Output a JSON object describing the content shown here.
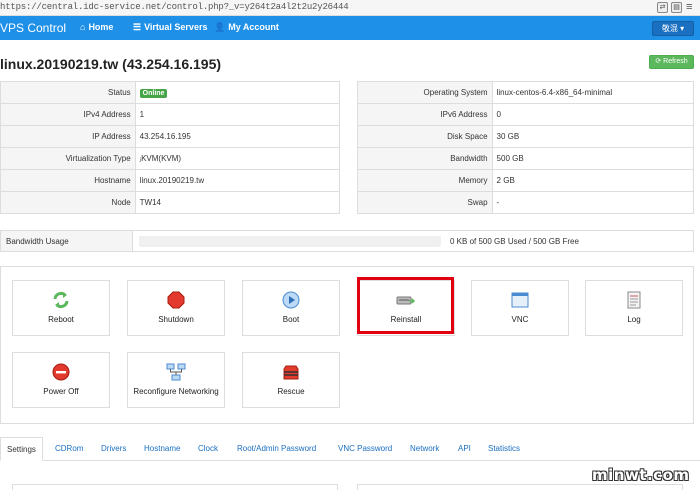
{
  "browser": {
    "url": "https://central.idc-service.net/control.php?_v=y264t2a4l2t2u2y26444"
  },
  "navbar": {
    "brand": "VPS Control",
    "items": [
      {
        "label": "Home",
        "icon": "home-icon"
      },
      {
        "label": "Virtual Servers",
        "icon": "list-icon"
      },
      {
        "label": "My Account",
        "icon": "user-icon"
      }
    ],
    "language": "敬混 ▾"
  },
  "header": {
    "title": "linux.20190219.tw (43.254.16.195)",
    "refresh_label": "Refresh"
  },
  "info_left": [
    {
      "label": "Status",
      "value": "Online"
    },
    {
      "label": "IPv4 Address",
      "value": "1"
    },
    {
      "label": "IP Address",
      "value": "43.254.16.195"
    },
    {
      "label": "Virtualization Type",
      "value": "ⱼKVM(KVM)"
    },
    {
      "label": "Hostname",
      "value": "linux.20190219.tw"
    },
    {
      "label": "Node",
      "value": "TW14"
    }
  ],
  "info_right": [
    {
      "label": "Operating System",
      "value": "linux-centos-6.4-x86_64-minimal"
    },
    {
      "label": "IPv6 Address",
      "value": "0"
    },
    {
      "label": "Disk Space",
      "value": "30 GB"
    },
    {
      "label": "Bandwidth",
      "value": "500 GB"
    },
    {
      "label": "Memory",
      "value": "2 GB"
    },
    {
      "label": "Swap",
      "value": "-"
    }
  ],
  "bandwidth": {
    "label": "Bandwidth Usage",
    "usage_text": "0 KB of 500 GB Used / 500 GB Free",
    "percent": 0
  },
  "actions": [
    {
      "label": "Reboot",
      "icon": "reboot-icon"
    },
    {
      "label": "Shutdown",
      "icon": "shutdown-icon"
    },
    {
      "label": "Boot",
      "icon": "boot-icon"
    },
    {
      "label": "Reinstall",
      "icon": "reinstall-icon"
    },
    {
      "label": "VNC",
      "icon": "vnc-icon"
    },
    {
      "label": "Log",
      "icon": "log-icon"
    },
    {
      "label": "Power Off",
      "icon": "power-off-icon"
    },
    {
      "label": "Reconfigure Networking",
      "icon": "network-icon"
    },
    {
      "label": "Rescue",
      "icon": "rescue-icon"
    }
  ],
  "tabs": [
    "Settings",
    "CDRom",
    "Drivers",
    "Hostname",
    "Clock",
    "Root/Admin Password",
    "VNC Password",
    "Network",
    "API",
    "Statistics"
  ],
  "watermark": "minwt.com",
  "colors": {
    "navbar": "#1e90e8",
    "online": "#46a546",
    "refresh": "#5cb85c",
    "highlight": "#e0000f",
    "link": "#1a6fc0"
  }
}
